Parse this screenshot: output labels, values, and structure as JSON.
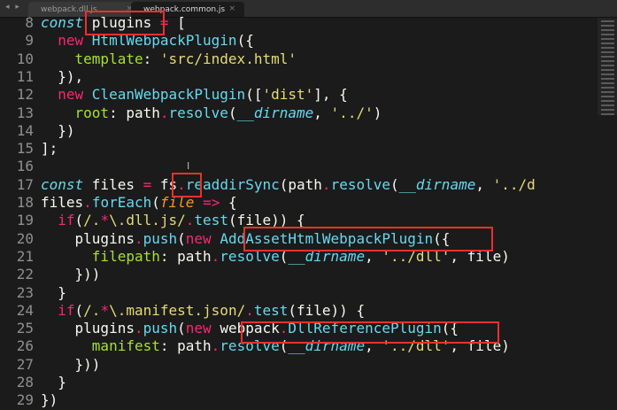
{
  "tabs": [
    {
      "label": "webpack.dll.js",
      "close": "×",
      "active": false
    },
    {
      "label": "webpack.common.js",
      "close": "×",
      "active": true
    }
  ],
  "nav_arrows": "◂ ▸",
  "lines": [
    {
      "n": "8",
      "tokens": [
        [
          "kw-i",
          "const "
        ],
        [
          "",
          "plugins "
        ],
        [
          "op",
          "="
        ],
        [
          "",
          " ["
        ]
      ]
    },
    {
      "n": "9",
      "tokens": [
        [
          "",
          "  "
        ],
        [
          "kw",
          "new "
        ],
        [
          "fn",
          "HtmlWebpackPlugin"
        ],
        [
          "",
          "({"
        ]
      ]
    },
    {
      "n": "10",
      "tokens": [
        [
          "",
          "    "
        ],
        [
          "prop",
          "template"
        ],
        [
          "",
          ": "
        ],
        [
          "str",
          "'src/index.html'"
        ]
      ]
    },
    {
      "n": "11",
      "tokens": [
        [
          "",
          "  }),"
        ]
      ]
    },
    {
      "n": "12",
      "tokens": [
        [
          "",
          "  "
        ],
        [
          "kw",
          "new "
        ],
        [
          "fn",
          "CleanWebpackPlugin"
        ],
        [
          "",
          "(["
        ],
        [
          "str",
          "'dist'"
        ],
        [
          "",
          "], {"
        ]
      ]
    },
    {
      "n": "13",
      "tokens": [
        [
          "",
          "    "
        ],
        [
          "prop",
          "root"
        ],
        [
          "",
          ": path"
        ],
        [
          "op",
          "."
        ],
        [
          "fn",
          "resolve"
        ],
        [
          "",
          "("
        ],
        [
          "it",
          "__dirname"
        ],
        [
          "",
          ", "
        ],
        [
          "str",
          "'../'"
        ],
        [
          "",
          ")"
        ]
      ]
    },
    {
      "n": "14",
      "tokens": [
        [
          "",
          "  })"
        ]
      ]
    },
    {
      "n": "15",
      "tokens": [
        [
          "",
          "];"
        ]
      ]
    },
    {
      "n": "16",
      "tokens": [
        [
          "",
          ""
        ]
      ]
    },
    {
      "n": "17",
      "tokens": [
        [
          "kw-i",
          "const "
        ],
        [
          "",
          "files "
        ],
        [
          "op",
          "="
        ],
        [
          "",
          " fs"
        ],
        [
          "op",
          "."
        ],
        [
          "fn",
          "readdirSync"
        ],
        [
          "",
          "(path"
        ],
        [
          "op",
          "."
        ],
        [
          "fn",
          "resolve"
        ],
        [
          "",
          "("
        ],
        [
          "it",
          "__dirname"
        ],
        [
          "",
          ", "
        ],
        [
          "str",
          "'../d"
        ]
      ]
    },
    {
      "n": "18",
      "tokens": [
        [
          "",
          "files"
        ],
        [
          "op",
          "."
        ],
        [
          "fn",
          "forEach"
        ],
        [
          "",
          "("
        ],
        [
          "param",
          "file"
        ],
        [
          "",
          " "
        ],
        [
          "kw",
          "=>"
        ],
        [
          "",
          " {"
        ]
      ]
    },
    {
      "n": "19",
      "tokens": [
        [
          "",
          "  "
        ],
        [
          "kw",
          "if"
        ],
        [
          "",
          "("
        ],
        [
          "str",
          "/."
        ],
        [
          "op",
          "*"
        ],
        [
          "str",
          "\\.dll.js/"
        ],
        [
          "op",
          "."
        ],
        [
          "fn",
          "test"
        ],
        [
          "",
          "(file)) {"
        ]
      ]
    },
    {
      "n": "20",
      "tokens": [
        [
          "",
          "    plugins"
        ],
        [
          "op",
          "."
        ],
        [
          "fn",
          "push"
        ],
        [
          "",
          "("
        ],
        [
          "kw",
          "new "
        ],
        [
          "fn",
          "AddAssetHtmlWebpackPlugin"
        ],
        [
          "",
          "({"
        ]
      ]
    },
    {
      "n": "21",
      "tokens": [
        [
          "",
          "      "
        ],
        [
          "prop",
          "filepath"
        ],
        [
          "",
          ": path"
        ],
        [
          "op",
          "."
        ],
        [
          "fn",
          "resolve"
        ],
        [
          "",
          "("
        ],
        [
          "it",
          "__dirname"
        ],
        [
          "",
          ", "
        ],
        [
          "str",
          "'../dll'"
        ],
        [
          "",
          ", file)"
        ]
      ]
    },
    {
      "n": "22",
      "tokens": [
        [
          "",
          "    }))"
        ]
      ]
    },
    {
      "n": "23",
      "tokens": [
        [
          "",
          "  }"
        ]
      ]
    },
    {
      "n": "24",
      "tokens": [
        [
          "",
          "  "
        ],
        [
          "kw",
          "if"
        ],
        [
          "",
          "("
        ],
        [
          "str",
          "/."
        ],
        [
          "op",
          "*"
        ],
        [
          "str",
          "\\.manifest.json/"
        ],
        [
          "op",
          "."
        ],
        [
          "fn",
          "test"
        ],
        [
          "",
          "(file)) {"
        ]
      ]
    },
    {
      "n": "25",
      "tokens": [
        [
          "",
          "    plugins"
        ],
        [
          "op",
          "."
        ],
        [
          "fn",
          "push"
        ],
        [
          "",
          "("
        ],
        [
          "kw",
          "new "
        ],
        [
          "",
          "webpack"
        ],
        [
          "op",
          "."
        ],
        [
          "fn",
          "DllReferencePlugin"
        ],
        [
          "",
          "({"
        ]
      ]
    },
    {
      "n": "26",
      "tokens": [
        [
          "",
          "      "
        ],
        [
          "prop",
          "manifest"
        ],
        [
          "",
          ": path"
        ],
        [
          "op",
          "."
        ],
        [
          "fn",
          "resolve"
        ],
        [
          "",
          "("
        ],
        [
          "it",
          "__dirname"
        ],
        [
          "",
          ", "
        ],
        [
          "str",
          "'../dll'"
        ],
        [
          "",
          ", file)"
        ]
      ]
    },
    {
      "n": "27",
      "tokens": [
        [
          "",
          "    }))"
        ]
      ]
    },
    {
      "n": "28",
      "tokens": [
        [
          "",
          "  }"
        ]
      ]
    },
    {
      "n": "29",
      "tokens": [
        [
          "",
          "})"
        ]
      ]
    }
  ],
  "highlights": [
    "plugins",
    "fs",
    "AddAssetHtmlWebpackPlugin",
    "webpack.DllReferencePlugin"
  ],
  "colors": {
    "background": "#1b1b1b",
    "keyword": "#f92672",
    "function": "#66d9ef",
    "string": "#e6db74",
    "property": "#a6e22e",
    "parameter": "#fd971f",
    "highlight_box": "#e8312f"
  },
  "cursor_glyph": "I"
}
